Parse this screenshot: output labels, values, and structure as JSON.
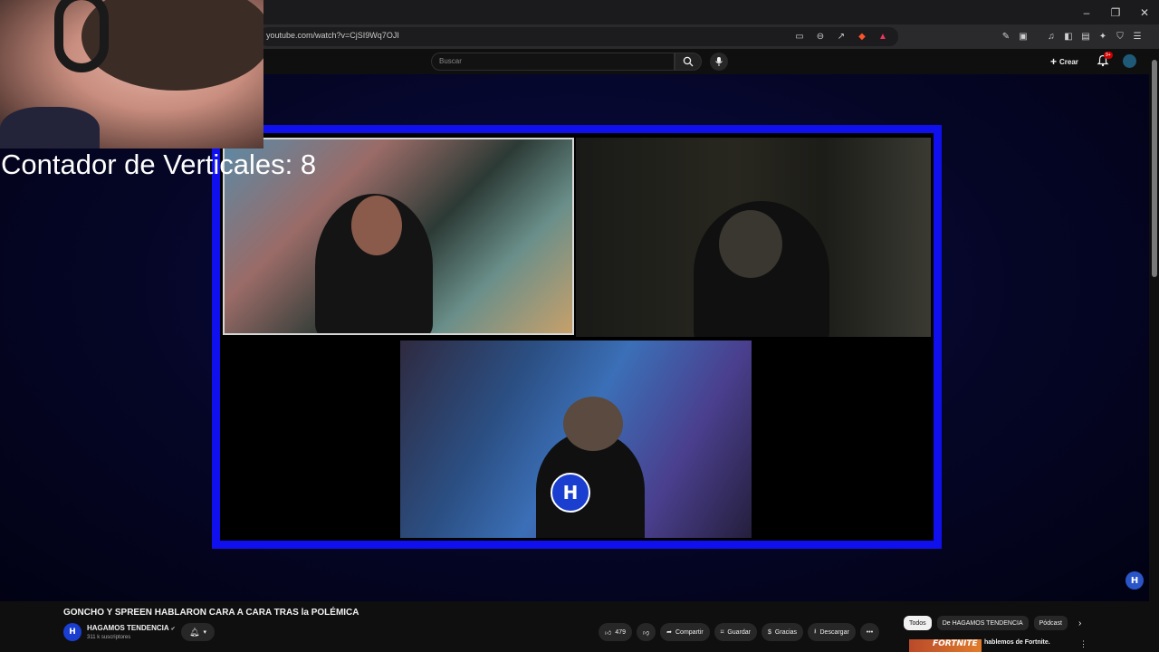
{
  "browser": {
    "url": "youtube.com/watch?v=CjSI9Wq7OJI",
    "window_controls": [
      "minimize-icon",
      "restore-icon",
      "close-icon"
    ],
    "bell_badge": "9+"
  },
  "header": {
    "search_placeholder": "Buscar",
    "create_label": "Crear"
  },
  "overlay": {
    "counter_text": "Contador de Verticales: 8"
  },
  "video": {
    "title": "GONCHO Y SPREEN HABLARON CARA A CARA TRAS la POLÉMICA",
    "logo_text": "H"
  },
  "channel": {
    "name": "HAGAMOS TENDENCIA",
    "verified_glyph": "✔",
    "subscribers": "311 k suscriptores"
  },
  "actions": {
    "likes": "479",
    "share": "Compartir",
    "save": "Guardar",
    "thanks": "Gracias",
    "download": "Descargar"
  },
  "chips": [
    "Todos",
    "De HAGAMOS TENDENCIA",
    "Pódcast"
  ],
  "recommendation": {
    "thumb_text": "FORTNITE",
    "title": "hablemos de Fortnite."
  }
}
